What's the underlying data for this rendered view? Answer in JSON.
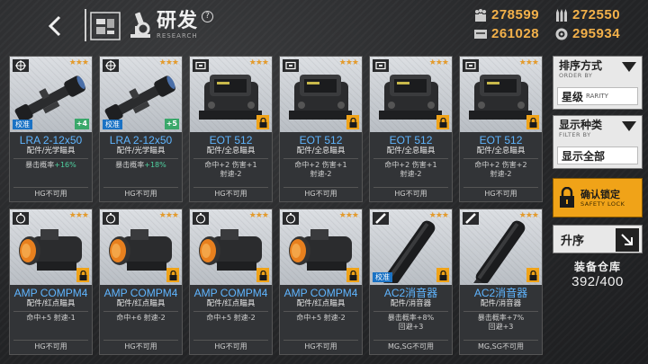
{
  "header": {
    "title": "研发",
    "subtitle": "RESEARCH",
    "help": "?"
  },
  "resources": [
    {
      "icon": "manpower-icon",
      "value": "278599"
    },
    {
      "icon": "ammo-icon",
      "value": "272550"
    },
    {
      "icon": "rations-icon",
      "value": "261028"
    },
    {
      "icon": "parts-icon",
      "value": "295934"
    }
  ],
  "colors": {
    "accent": "#f0a318",
    "name_blue": "#5fb5ff",
    "stat_green": "#4fd1a0",
    "resource_gold": "#f3b14a"
  },
  "cards": [
    {
      "icon": "scope-type-icon",
      "stars": "★★★",
      "art": "rifle-scope",
      "tag": "校准",
      "badge": "+4",
      "name": "LRA 2-12x50",
      "type": "配件/光学瞄具",
      "stats_pre": "暴击概率",
      "stats_hl": "+16%",
      "stats_line2": "",
      "restrict": "HG不可用"
    },
    {
      "icon": "scope-type-icon",
      "stars": "★★★",
      "art": "rifle-scope",
      "tag": "校准",
      "badge": "+5",
      "name": "LRA 2-12x50",
      "type": "配件/光学瞄具",
      "stats_pre": "暴击概率",
      "stats_hl": "+18%",
      "stats_line2": "",
      "restrict": "HG不可用"
    },
    {
      "icon": "holo-type-icon",
      "stars": "★★★",
      "art": "holo-sight",
      "tag": "",
      "badge": "lock",
      "name": "EOT 512",
      "type": "配件/全息瞄具",
      "stats_pre": "命中+2 伤害+1",
      "stats_hl": "",
      "stats_line2": "射速-2",
      "restrict": "HG不可用"
    },
    {
      "icon": "holo-type-icon",
      "stars": "★★★",
      "art": "holo-sight",
      "tag": "",
      "badge": "lock",
      "name": "EOT 512",
      "type": "配件/全息瞄具",
      "stats_pre": "命中+2 伤害+1",
      "stats_hl": "",
      "stats_line2": "射速-2",
      "restrict": "HG不可用"
    },
    {
      "icon": "holo-type-icon",
      "stars": "★★★",
      "art": "holo-sight",
      "tag": "",
      "badge": "lock",
      "name": "EOT 512",
      "type": "配件/全息瞄具",
      "stats_pre": "命中+2 伤害+1",
      "stats_hl": "",
      "stats_line2": "射速-2",
      "restrict": "HG不可用"
    },
    {
      "icon": "holo-type-icon",
      "stars": "★★★",
      "art": "holo-sight",
      "tag": "",
      "badge": "lock",
      "name": "EOT 512",
      "type": "配件/全息瞄具",
      "stats_pre": "命中+2 伤害+2",
      "stats_hl": "",
      "stats_line2": "射速-2",
      "restrict": "HG不可用"
    },
    {
      "icon": "reddot-type-icon",
      "stars": "★★★",
      "art": "red-dot",
      "tag": "",
      "badge": "lock",
      "name": "AMP COMPM4",
      "type": "配件/红点瞄具",
      "stats_pre": "命中+5 射速-1",
      "stats_hl": "",
      "stats_line2": "",
      "restrict": "HG不可用"
    },
    {
      "icon": "reddot-type-icon",
      "stars": "★★★",
      "art": "red-dot",
      "tag": "",
      "badge": "lock",
      "name": "AMP COMPM4",
      "type": "配件/红点瞄具",
      "stats_pre": "命中+6 射速-2",
      "stats_hl": "",
      "stats_line2": "",
      "restrict": "HG不可用"
    },
    {
      "icon": "reddot-type-icon",
      "stars": "★★★",
      "art": "red-dot",
      "tag": "",
      "badge": "lock",
      "name": "AMP COMPM4",
      "type": "配件/红点瞄具",
      "stats_pre": "命中+5 射速-2",
      "stats_hl": "",
      "stats_line2": "",
      "restrict": "HG不可用"
    },
    {
      "icon": "reddot-type-icon",
      "stars": "★★★",
      "art": "red-dot",
      "tag": "",
      "badge": "lock",
      "name": "AMP COMPM4",
      "type": "配件/红点瞄具",
      "stats_pre": "命中+5 射速-2",
      "stats_hl": "",
      "stats_line2": "",
      "restrict": "HG不可用"
    },
    {
      "icon": "suppressor-type-icon",
      "stars": "★★★",
      "art": "suppressor",
      "tag": "校准",
      "badge": "lock",
      "name": "AC2消音器",
      "type": "配件/消音器",
      "stats_pre": "暴击概率+8%",
      "stats_hl": "",
      "stats_line2": "回避+3",
      "restrict": "MG,SG不可用"
    },
    {
      "icon": "suppressor-type-icon",
      "stars": "★★★",
      "art": "suppressor",
      "tag": "",
      "badge": "lock",
      "name": "AC2消音器",
      "type": "配件/消音器",
      "stats_pre": "暴击概率+7%",
      "stats_hl": "",
      "stats_line2": "回避+3",
      "restrict": "MG,SG不可用"
    }
  ],
  "panel": {
    "sort_label": "排序方式",
    "sort_sub": "ORDER BY",
    "sort_value": "星级",
    "sort_value_sub": "RARITY",
    "filter_label": "显示种类",
    "filter_sub": "FILTER BY",
    "filter_value": "显示全部",
    "lock_label": "确认锁定",
    "lock_sub": "SAFETY LOCK",
    "asc_label": "升序",
    "storage_label": "装备仓库",
    "storage_count": "392/400"
  }
}
